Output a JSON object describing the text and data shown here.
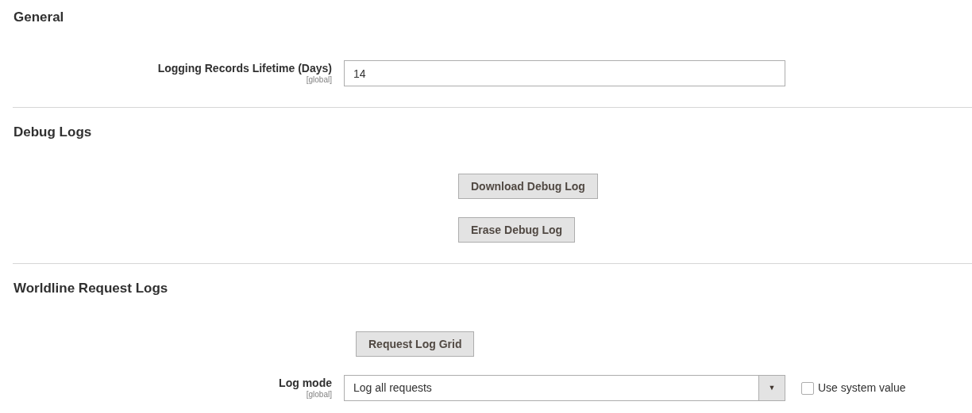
{
  "sections": [
    {
      "title": "General",
      "rows": [
        {
          "kind": "input",
          "label": "Logging Records Lifetime (Days)",
          "scope": "[global]",
          "value": "14"
        }
      ]
    },
    {
      "title": "Debug Logs",
      "rows": [
        {
          "kind": "offset_button",
          "text": "Download Debug Log"
        },
        {
          "kind": "offset_button",
          "text": "Erase Debug Log"
        }
      ]
    },
    {
      "title": "Worldline Request Logs",
      "rows": [
        {
          "kind": "button",
          "text": "Request Log Grid"
        },
        {
          "kind": "select",
          "label": "Log mode",
          "scope": "[global]",
          "value": "Log all requests",
          "arrow": "▼",
          "inherit": {
            "label": "Use system value",
            "checked": false
          }
        }
      ]
    }
  ]
}
